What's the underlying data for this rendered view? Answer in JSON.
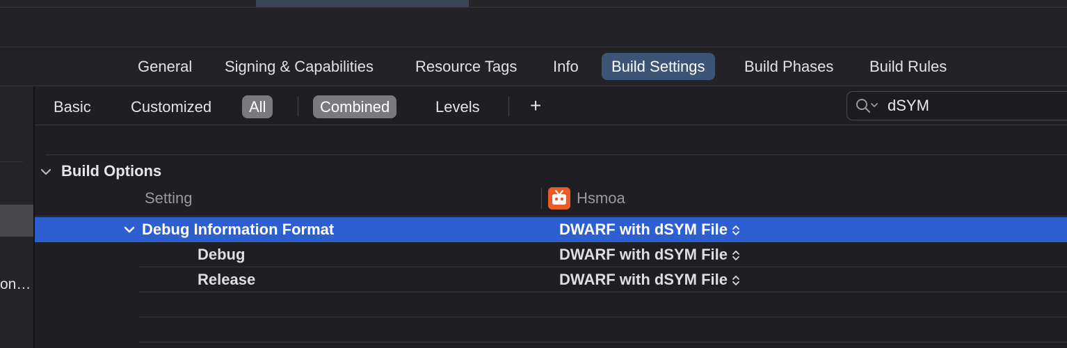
{
  "editor_tabs": {
    "general": "General",
    "signing": "Signing & Capabilities",
    "resource_tags": "Resource Tags",
    "info": "Info",
    "build_settings": "Build Settings",
    "build_phases": "Build Phases",
    "build_rules": "Build Rules",
    "selected": "Build Settings"
  },
  "filter_bar": {
    "basic": "Basic",
    "customized": "Customized",
    "all": "All",
    "combined": "Combined",
    "levels": "Levels",
    "add": "+"
  },
  "search": {
    "value": "dSYM"
  },
  "sidebar": {
    "truncated_item": "on…"
  },
  "section": {
    "title": "Build Options",
    "columns": {
      "setting": "Setting",
      "target": "Hsmoa"
    },
    "rows": [
      {
        "name": "Debug Information Format",
        "value": "DWARF with dSYM File"
      },
      {
        "name": "Debug",
        "value": "DWARF with dSYM File"
      },
      {
        "name": "Release",
        "value": "DWARF with dSYM File"
      }
    ]
  },
  "colors": {
    "selected_tab": "#3c5476",
    "selected_row": "#2d5fd1",
    "target_icon": "#ea5a2a"
  },
  "icons": {
    "search": "magnifier-with-dropdown-icon",
    "disclosure": "chevron-down-icon",
    "popup": "up-down-arrows-icon",
    "target": "app-target-icon"
  }
}
